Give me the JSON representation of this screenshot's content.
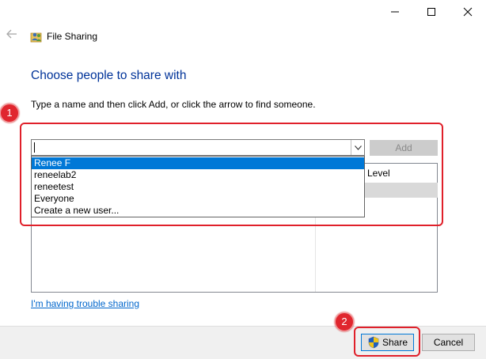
{
  "window": {
    "title": "File Sharing",
    "controls": {
      "minimize": "—",
      "maximize": "☐",
      "close": "✕"
    },
    "back_glyph": "←"
  },
  "main": {
    "heading": "Choose people to share with",
    "instruction": "Type a name and then click Add, or click the arrow to find someone.",
    "name_input_value": "",
    "add_button": "Add",
    "list_column_level": "Level",
    "dropdown_items": [
      "Renee F",
      "reneelab2",
      "reneetest",
      "Everyone",
      "Create a new user..."
    ],
    "dropdown_selected_index": 0,
    "trouble_link": "I'm having trouble sharing"
  },
  "footer": {
    "share_button": "Share",
    "cancel_button": "Cancel"
  },
  "annotations": {
    "badge_1": "1",
    "badge_2": "2",
    "color": "#e0202a"
  },
  "colors": {
    "heading": "#003399",
    "selection": "#0078d7",
    "link": "#0066cc"
  }
}
